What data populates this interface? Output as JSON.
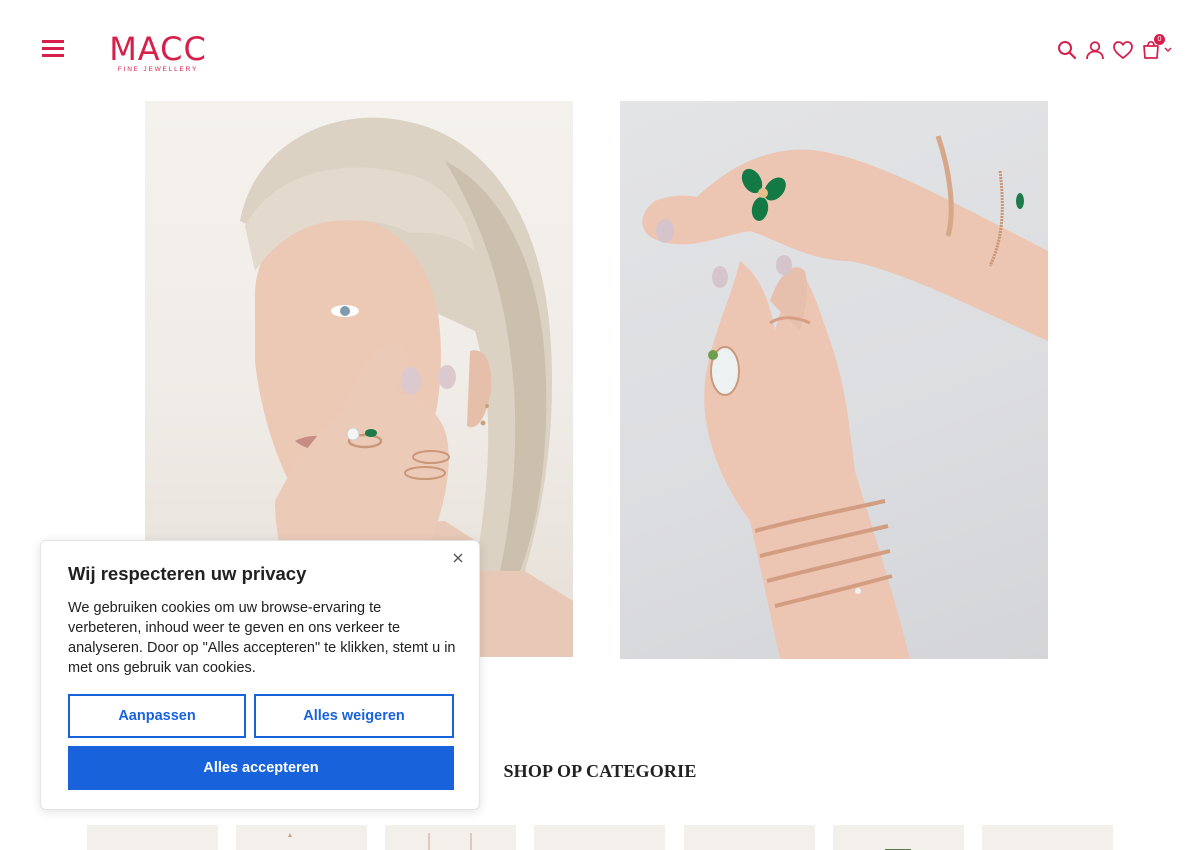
{
  "header": {
    "menu_icon": "hamburger-menu-icon",
    "logo": {
      "main": "MACC",
      "sub": "FINE JEWELLERY"
    },
    "icons": [
      "search-icon",
      "user-icon",
      "heart-icon",
      "cart-icon"
    ],
    "cart_count": "0"
  },
  "main": {
    "images": [
      {
        "alt": ""
      },
      {
        "alt": ""
      }
    ],
    "category_section": {
      "title": "SHOP OP CATEGORIE",
      "tiles": 7
    }
  },
  "cookie_banner": {
    "title": "Wij respecteren uw privacy",
    "text": "We gebruiken cookies om uw browse-ervaring te verbeteren,  inhoud weer te geven en ons verkeer te analyseren. Door op \"Alles accepteren\" te klikken, stemt u in met ons gebruik van cookies.",
    "customize_label": "Aanpassen",
    "reject_label": "Alles weigeren",
    "accept_label": "Alles accepteren"
  },
  "colors": {
    "brand": "#d6204b",
    "accent": "#1863dc"
  }
}
